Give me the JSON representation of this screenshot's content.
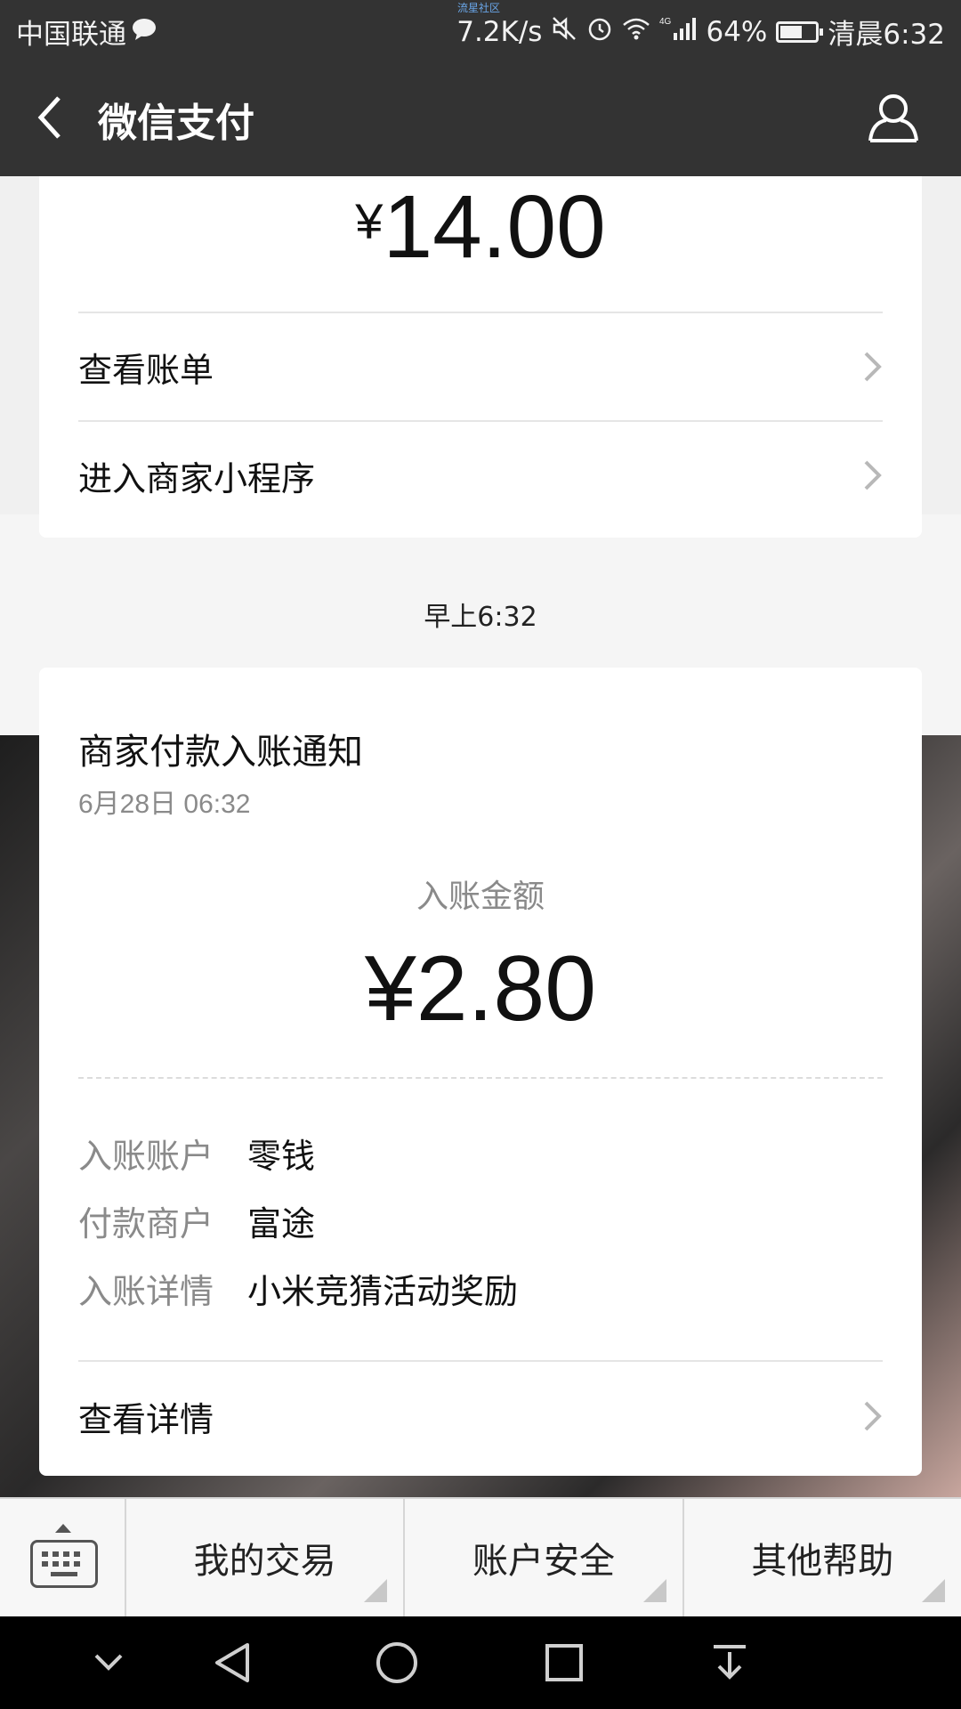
{
  "status_bar": {
    "carrier": "中国联通",
    "tiny_text": "流星社区",
    "net_speed": "7.2K/s",
    "network": "4G",
    "battery_percent": "64%",
    "battery_level": 0.64,
    "time": "清晨6:32",
    "icons": [
      "chat-bubble-icon",
      "mute-icon",
      "alarm-icon",
      "wifi-icon",
      "signal-icon",
      "battery-icon"
    ]
  },
  "header": {
    "title": "微信支付",
    "back_icon": "chevron-left-icon",
    "profile_icon": "person-icon"
  },
  "message1": {
    "amount_symbol": "¥",
    "amount_value": "14.00",
    "link1": "查看账单",
    "link2": "进入商家小程序"
  },
  "time_divider": "早上6:32",
  "message2": {
    "title": "商家付款入账通知",
    "date": "6月28日  06:32",
    "amount_label": "入账金额",
    "amount": "¥2.80",
    "details": [
      {
        "key": "入账账户",
        "value": "零钱"
      },
      {
        "key": "付款商户",
        "value": "富途"
      },
      {
        "key": "入账详情",
        "value": "小米竞猜活动奖励"
      }
    ],
    "link": "查看详情"
  },
  "bottom_menu": {
    "keyboard_icon": "keyboard-icon",
    "items": [
      "我的交易",
      "账户安全",
      "其他帮助"
    ]
  },
  "nav_bar": {
    "icons": [
      "chevron-down-icon",
      "back-triangle-icon",
      "home-circle-icon",
      "recent-square-icon",
      "notification-pull-icon"
    ]
  },
  "colors": {
    "header_bg": "#333333",
    "card_bg": "#ffffff",
    "muted_text": "#8a8a8a"
  }
}
